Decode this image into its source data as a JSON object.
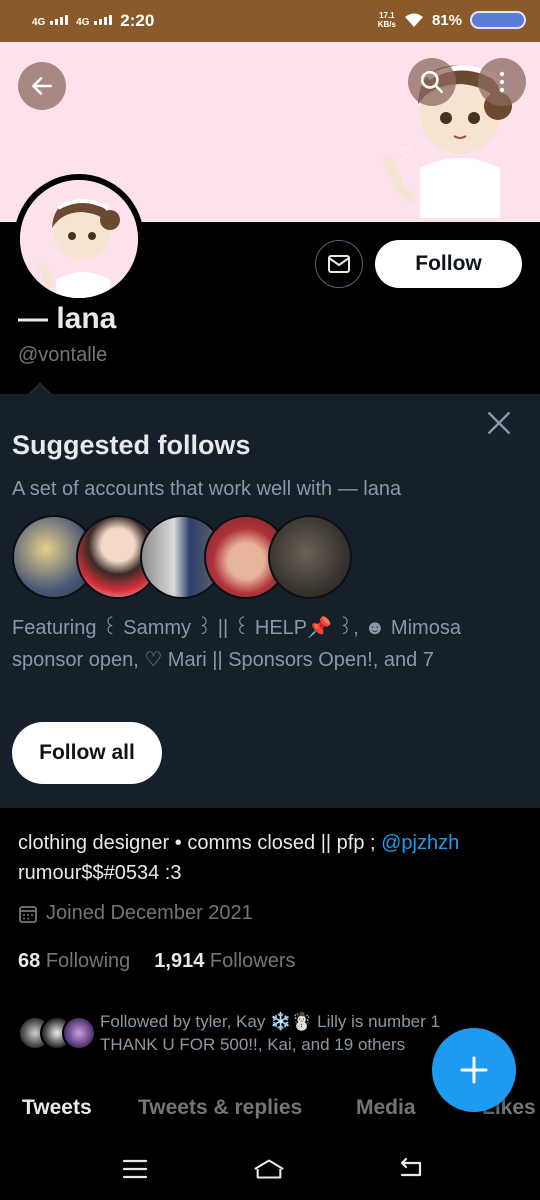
{
  "status_bar": {
    "network1": "4G",
    "network2": "4G",
    "time": "2:20",
    "net_speed_value": "17.1",
    "net_speed_unit": "KB/s",
    "battery": "81%",
    "wifi_icon": "wifi-icon"
  },
  "header": {
    "back_icon": "arrow-left-icon",
    "search_icon": "search-icon",
    "more_icon": "more-icon",
    "banner_color": "#fde2ee"
  },
  "profile": {
    "display_name": "— lana",
    "handle": "@vontalle",
    "follow_label": "Follow",
    "message_icon": "mail-icon"
  },
  "suggested": {
    "title": "Suggested follows",
    "subtitle": "A set of accounts that work well with — lana",
    "featuring": "Featuring ꒰ Sammy ꒱ || ꒰ HELP📌 ꒱, ☻ Mimosa sponsor open, ♡ Mari || Sponsors Open!, and 7",
    "follow_all_label": "Follow all",
    "close_icon": "close-icon"
  },
  "bio": {
    "text_before_mention": "clothing designer • comms closed || pfp ; ",
    "mention": "@pjzhzh",
    "text_after_mention": "rumour$$#0534 :3"
  },
  "joined": "Joined December 2021",
  "stats": {
    "following_count": "68",
    "following_label": "Following",
    "followers_count": "1,914",
    "followers_label": "Followers"
  },
  "followed_by": {
    "line1": "Followed by tyler, Kay ❄️☃️ Lilly is number 1",
    "line2": "THANK U FOR 500!!, Kai, and 19 others"
  },
  "tabs": [
    "Tweets",
    "Tweets & replies",
    "Media",
    "Likes"
  ],
  "accent_color": "#1d9bf0"
}
